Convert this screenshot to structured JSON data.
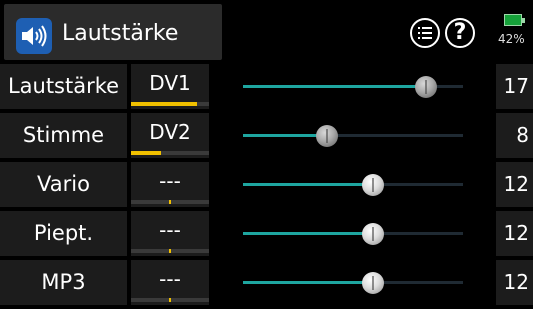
{
  "header": {
    "title": "Lautstärke",
    "app_icon": "speaker-icon",
    "menu_icon": "list-menu-icon",
    "help_icon": "question-icon",
    "help_glyph": "?",
    "battery_icon": "battery-icon",
    "battery_percent": "42%"
  },
  "rows": [
    {
      "name": "Lautstärke",
      "control": "DV1",
      "control_level": 0.85,
      "slider": 0.83,
      "value": "17"
    },
    {
      "name": "Stimme",
      "control": "DV2",
      "control_level": 0.38,
      "slider": 0.38,
      "value": "8"
    },
    {
      "name": "Vario",
      "control": "---",
      "control_level": null,
      "slider": 0.59,
      "value": "12"
    },
    {
      "name": "Piept.",
      "control": "---",
      "control_level": null,
      "slider": 0.59,
      "value": "12"
    },
    {
      "name": "MP3",
      "control": "---",
      "control_level": null,
      "slider": 0.59,
      "value": "12"
    }
  ],
  "colors": {
    "accent": "#1ea6a0",
    "control_bar": "#f0c000",
    "app_icon_bg": "#1e5fb3",
    "battery": "#16a23a"
  }
}
